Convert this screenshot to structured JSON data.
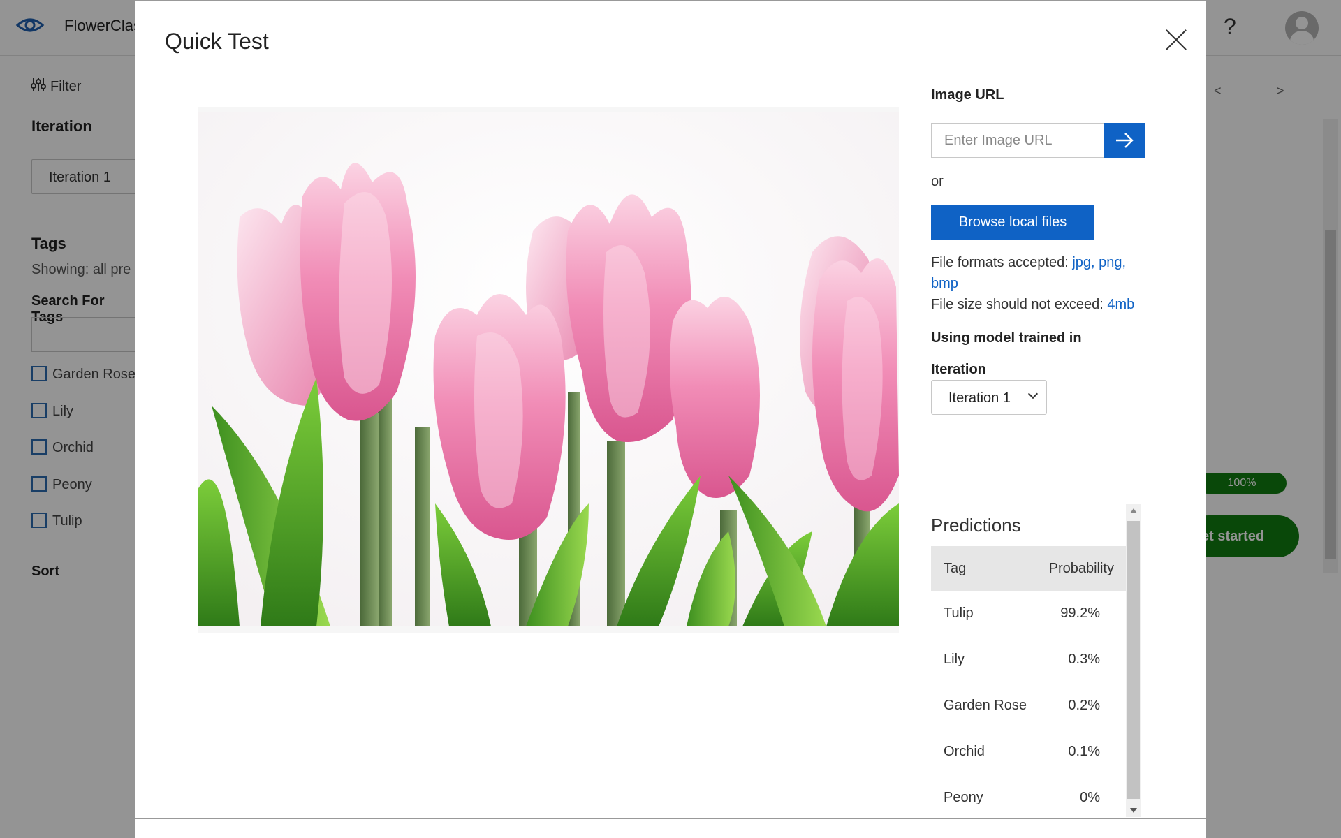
{
  "app": {
    "title": "FlowerClas",
    "help": "?"
  },
  "background": {
    "filter_label": "Filter",
    "iteration_heading": "Iteration",
    "iteration_value": "Iteration 1",
    "tags_heading": "Tags",
    "showing_text": "Showing: all pre",
    "search_heading": "Search For Tags",
    "tags": [
      "Garden Rose",
      "Lily",
      "Orchid",
      "Peony",
      "Tulip"
    ],
    "sort_heading": "Sort",
    "pager_prev": "<",
    "pager_next": ">",
    "progress_label": "100%",
    "progress_value": 1.0,
    "get_started_label": "et started"
  },
  "modal": {
    "title": "Quick Test",
    "image_alt": "pink tulips",
    "image_url_label": "Image URL",
    "url_placeholder": "Enter Image URL",
    "or_text": "or",
    "browse_label": "Browse local files",
    "formats_prefix": "File formats accepted: ",
    "formats_link_1": "jpg, png,",
    "formats_link_2": "bmp",
    "size_prefix": "File size should not exceed: ",
    "size_link": "4mb",
    "model_heading": "Using model trained in",
    "iteration_label": "Iteration",
    "iteration_selected": "Iteration 1",
    "predictions_title": "Predictions",
    "col_tag": "Tag",
    "col_probability": "Probability",
    "predictions": [
      {
        "tag": "Tulip",
        "probability": "99.2%"
      },
      {
        "tag": "Lily",
        "probability": "0.3%"
      },
      {
        "tag": "Garden Rose",
        "probability": "0.2%"
      },
      {
        "tag": "Orchid",
        "probability": "0.1%"
      },
      {
        "tag": "Peony",
        "probability": "0%"
      }
    ]
  },
  "colors": {
    "accent_blue": "#0f62c5",
    "success_green": "#107c10"
  }
}
